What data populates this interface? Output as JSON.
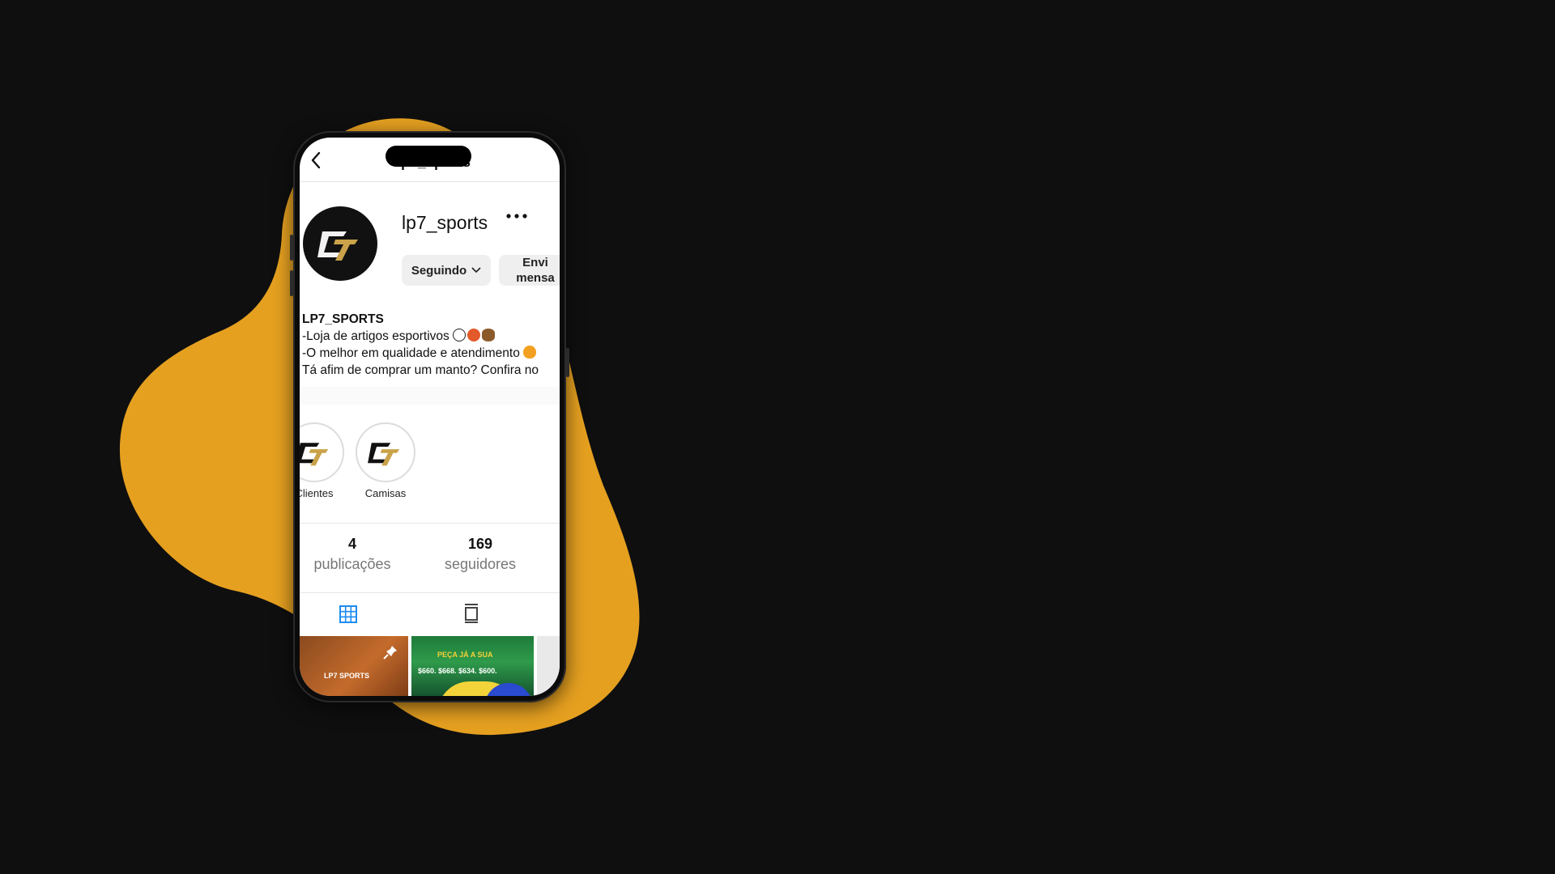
{
  "colors": {
    "background": "#0f0f0f",
    "blob": "#e5a020",
    "grid_tab_accent": "#1e8cf0"
  },
  "topbar": {
    "title": "lp7_sports",
    "back_icon": "chevron-left-icon"
  },
  "profile": {
    "username": "lp7_sports",
    "more_icon": "more-horizontal-icon",
    "avatar_text": "LP7",
    "follow_button": "Seguindo",
    "message_button_line1": "Envi",
    "message_button_line2": "mensa"
  },
  "bio": {
    "name": "LP7_SPORTS",
    "line1": "-Loja de artigos esportivos",
    "line2": "-O melhor em qualidade e atendimento",
    "line3": "Tá afim de comprar um manto? Confira no"
  },
  "highlights": [
    {
      "label": "Clientes"
    },
    {
      "label": "Camisas"
    }
  ],
  "stats": {
    "posts_count": "4",
    "posts_label": "publicações",
    "followers_count": "169",
    "followers_label": "seguidores"
  },
  "posts": [
    {
      "caption": "LP7 SPORTS",
      "pinned": true
    },
    {
      "caption": "PEÇA JÁ A SUA",
      "prices": "$660. $668. $634. $600."
    },
    {
      "caption": ""
    }
  ]
}
